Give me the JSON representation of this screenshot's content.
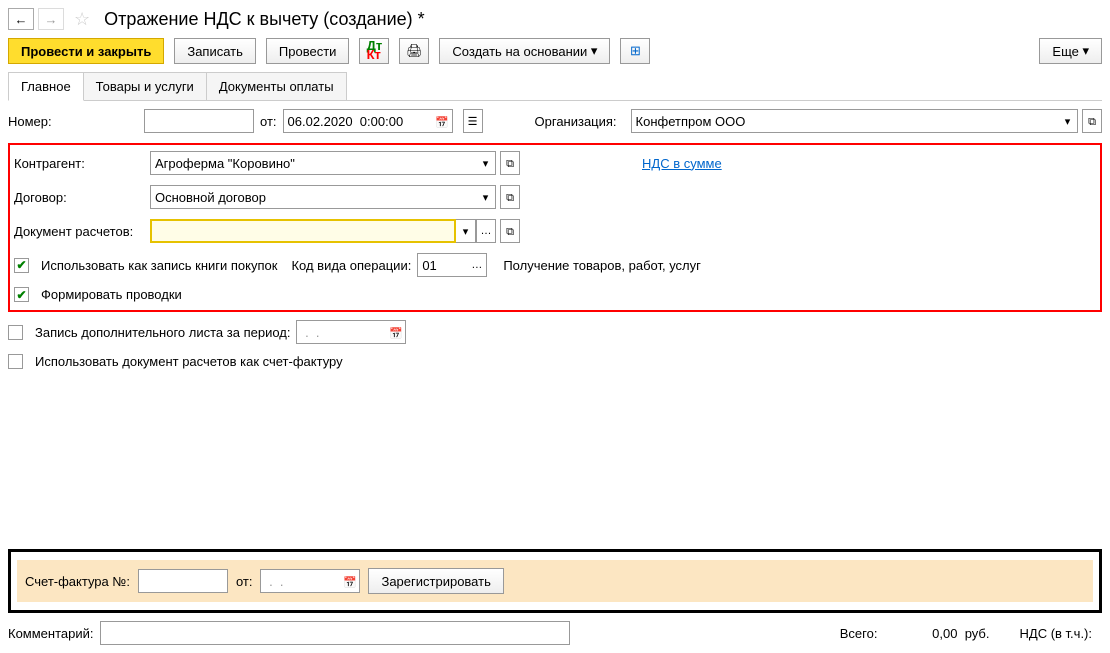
{
  "nav": {
    "title": "Отражение НДС к вычету (создание) *"
  },
  "toolbar": {
    "post_close": "Провести и закрыть",
    "save": "Записать",
    "post": "Провести",
    "create_based": "Создать на основании",
    "more": "Еще"
  },
  "tabs": {
    "main": "Главное",
    "goods": "Товары и услуги",
    "paydocs": "Документы оплаты"
  },
  "header_row": {
    "number_label": "Номер:",
    "number_value": "",
    "from_label": "от:",
    "date_value": "06.02.2020  0:00:00",
    "org_label": "Организация:",
    "org_value": "Конфетпром ООО"
  },
  "main": {
    "counterparty_label": "Контрагент:",
    "counterparty_value": "Агроферма \"Коровино\"",
    "nds_link": "НДС в сумме",
    "contract_label": "Договор:",
    "contract_value": "Основной договор",
    "calc_doc_label": "Документ расчетов:",
    "calc_doc_value": "",
    "cb_book_label": "Использовать как запись книги покупок",
    "op_code_label": "Код вида операции:",
    "op_code_value": "01",
    "op_code_desc": "Получение товаров, работ, услуг",
    "cb_postings_label": "Формировать проводки",
    "cb_addsheet_label": "Запись дополнительного листа за период:",
    "addsheet_date": " .  .    ",
    "cb_use_as_invoice_label": "Использовать документ расчетов как счет-фактуру"
  },
  "invoice": {
    "label": "Счет-фактура №:",
    "number_value": "",
    "from_label": "от:",
    "date_value": " .  .    ",
    "register_btn": "Зарегистрировать"
  },
  "totals": {
    "total_label": "Всего:",
    "total_value": "0,00",
    "currency": "руб.",
    "nds_label": "НДС (в т.ч.):"
  },
  "comment": {
    "label": "Комментарий:"
  }
}
